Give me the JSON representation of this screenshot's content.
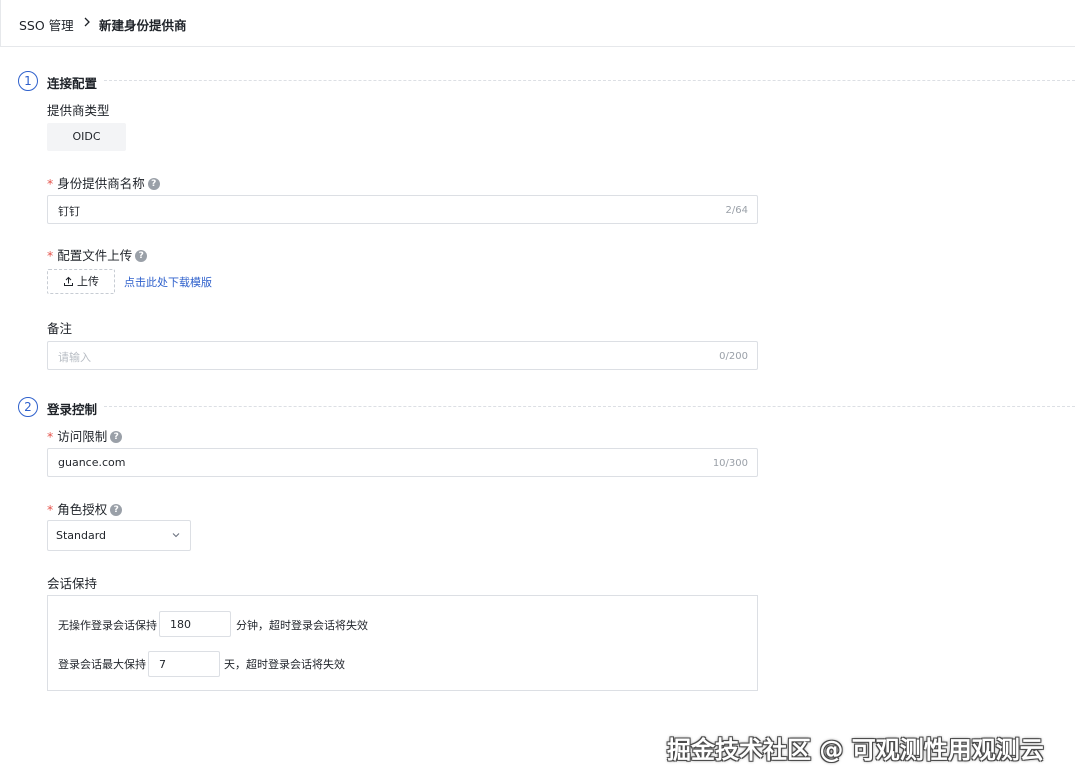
{
  "breadcrumb": {
    "root": "SSO 管理",
    "current": "新建身份提供商"
  },
  "steps": [
    {
      "number": "1",
      "title": "连接配置"
    },
    {
      "number": "2",
      "title": "登录控制"
    }
  ],
  "provider_type": {
    "label": "提供商类型",
    "value": "OIDC"
  },
  "provider_name": {
    "required_mark": "*",
    "label": "身份提供商名称",
    "value": "钉钉",
    "count": "2/64"
  },
  "config_upload": {
    "required_mark": "*",
    "label": "配置文件上传",
    "button_label": "上传",
    "template_link": "点击此处下载模版"
  },
  "remark": {
    "label": "备注",
    "placeholder": "请输入",
    "count": "0/200"
  },
  "access_limit": {
    "required_mark": "*",
    "label": "访问限制",
    "value": "guance.com",
    "count": "10/300"
  },
  "role": {
    "required_mark": "*",
    "label": "角色授权",
    "value": "Standard"
  },
  "session": {
    "label": "会话保持",
    "idle_prefix": "无操作登录会话保持",
    "idle_value": "180",
    "idle_suffix": "分钟，超时登录会话将失效",
    "max_prefix": "登录会话最大保持",
    "max_value": "7",
    "max_suffix": "天，超时登录会话将失效"
  },
  "help_glyph": "?",
  "watermark": "掘金技术社区 @ 可观测性用观测云",
  "colors": {
    "accent": "#2f61cc",
    "required": "#e5534b",
    "border": "#dcdfe4"
  },
  "icons": [
    "chevron-right-icon",
    "help-icon",
    "upload-icon",
    "chevron-down-icon"
  ]
}
